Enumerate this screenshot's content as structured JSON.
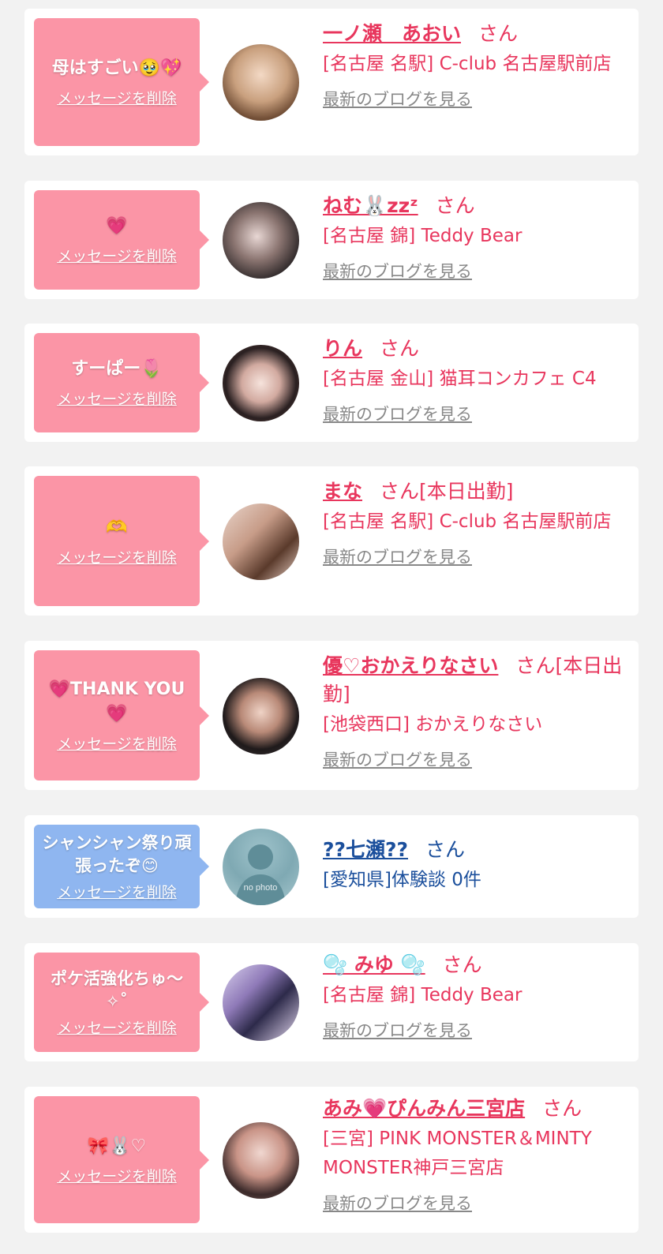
{
  "delete_label": "メッセージを削除",
  "blog_label": "最新のブログを見る",
  "san": "さん",
  "items": [
    {
      "message": "母はすごい🥹💖",
      "name": "一ノ瀬　あおい",
      "status": "",
      "shop": "[名古屋 名駅] C-club 名古屋駅前店",
      "blog": true,
      "bubble": "pink"
    },
    {
      "message": "💗",
      "name": "ねむ🐰zzᶻ",
      "status": "",
      "shop": "[名古屋 錦] Teddy Bear",
      "blog": true,
      "bubble": "pink"
    },
    {
      "message": "すーぱー🌷",
      "name": "りん",
      "status": "",
      "shop": "[名古屋 金山] 猫耳コンカフェ C4",
      "blog": true,
      "bubble": "pink"
    },
    {
      "message": "🫶",
      "name": "まな",
      "status": "[本日出勤]",
      "shop": "[名古屋 名駅] C-club 名古屋駅前店",
      "blog": true,
      "bubble": "pink"
    },
    {
      "message": "💗THANK YOU💗",
      "name": "優♡おかえりなさい",
      "status": "[本日出勤]",
      "shop": "[池袋西口] おかえりなさい",
      "blog": true,
      "bubble": "pink"
    },
    {
      "message": "シャンシャン祭り頑張ったぞ😊",
      "name": "??七瀬??",
      "status": "",
      "shop": "[愛知県]体験談 0件",
      "blog": false,
      "bubble": "blue"
    },
    {
      "message": "ポケ活強化ちゅ〜✧˚",
      "name": "🫧 みゆ 🫧",
      "status": "",
      "shop": "[名古屋 錦] Teddy Bear",
      "blog": true,
      "bubble": "pink"
    },
    {
      "message": "🎀🐰♡",
      "name": "あみ💗ぴんみん三宮店",
      "status": "",
      "shop": "[三宮] PINK MONSTER＆MINTY MONSTER神戸三宮店",
      "blog": true,
      "bubble": "pink"
    }
  ]
}
